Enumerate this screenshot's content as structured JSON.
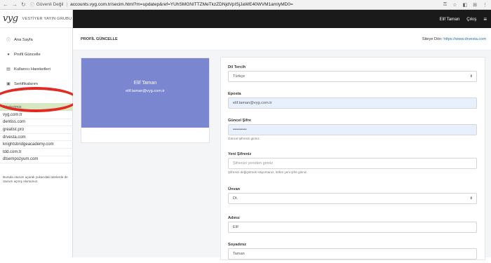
{
  "browser": {
    "secure_label": "Güvenli Değil",
    "url": "accounts.vyg.com.tr/secim.html?m=updatep&ref=YUhSMGNITTZMeTkzZDNjdVpISjJaWE40WVM1amIyMD0="
  },
  "sidebar": {
    "logo_mark": "vyg",
    "brand": "VESTİYER YAYIN GRUBU",
    "items": [
      {
        "label": "Ana Sayfa",
        "icon": "info-circle-icon"
      },
      {
        "label": "Profil Güncelle",
        "icon": "user-icon"
      },
      {
        "label": "Kullanıcı Hareketleri",
        "icon": "table-icon"
      },
      {
        "label": "Sertifikalarım",
        "icon": "certificate-icon"
      }
    ],
    "sites_header": "Sitelerimiz",
    "sites": [
      "vyg.com.tr",
      "dentiss.com",
      "greatist.pro",
      "drvesta.com",
      "knightsbridgeacademy.com",
      "tdd.com.tr",
      "dtsempozyum.com"
    ],
    "note": "Burada oturum açarak yukarıdaki sitelerde de oturum açmış olursunuz."
  },
  "topbar": {
    "user_name": "Elif Taman",
    "logout": "Çıkış"
  },
  "subheader": {
    "title": "PROFİL GÜNCELLE",
    "back_label": "Siteye Dön:",
    "back_link": "https://www.drvesta.com"
  },
  "profile": {
    "name": "Elif Taman",
    "email": "elif.taman@vyg.com.tr"
  },
  "form": {
    "language": {
      "label": "Dil Tercih",
      "value": "Türkçe"
    },
    "email": {
      "label": "Eposta",
      "value": "elif.taman@vyg.com.tr"
    },
    "current_password": {
      "label": "Güncel Şifre",
      "value": "••••••••••",
      "hint": "Güncel şifrenizi giriniz."
    },
    "new_password": {
      "label": "Yeni Şifreniz",
      "placeholder": "Şifrenizi yeniden giriniz",
      "hint": "Şifrenizi değiştirmek istiyorsanız, lütfen yeni şifre giriniz."
    },
    "title": {
      "label": "Ünvan",
      "value": "Dt."
    },
    "first_name": {
      "label": "Adınız",
      "value": "Elif"
    },
    "last_name": {
      "label": "Soyadınız",
      "value": "Taman"
    }
  }
}
